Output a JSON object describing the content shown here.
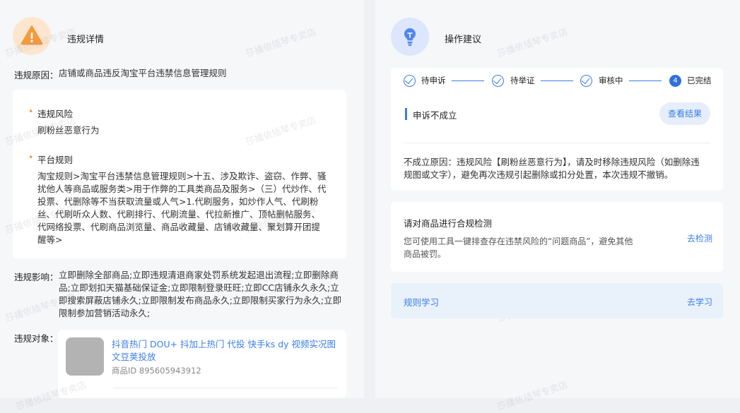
{
  "violation": {
    "title": "违规详情",
    "reason_label": "违规原因：",
    "reason_text": "店铺或商品违反淘宝平台违禁信息管理规则",
    "risk_title": "违规风险",
    "risk_text": "刷粉丝恶意行为",
    "rule_title": "平台规则",
    "rule_lines": [
      "淘宝规则>淘宝平台违禁信息管理规则>十五、涉及欺诈、盗窃、作弊、骚",
      "扰他人等商品或服务类>用于作弊的工具类商品及服务>（三）代炒作、代",
      "投票、代删除等不当获取流量或人气>1.代刷服务，如炒作人气、代刷粉",
      "丝、代刷听众人数、代刷排行、代刷流量、代拉新推广、顶帖删帖服务、",
      "代网络投票、代刷商品浏览量、商品收藏量、店铺收藏量、聚划算开团提",
      "醒等>"
    ],
    "impact_label": "违规影响：",
    "impact_lines": [
      "立即删除全部商品;立即违规清退商家处罚系统发起退出流程;立即删除商",
      "品;立即划扣天猫基础保证金;立即限制登录旺旺;立即CC店铺永久永久;立",
      "即搜索屏蔽店铺永久;立即限制发布商品永久;立即限制买家行为永久;立即",
      "限制参加营销活动永久;"
    ],
    "object_label": "违规对象：",
    "product_title_lines": [
      "抖音热门 DOU+ 抖加上热门 代投 快手ks dy 视频实况图",
      "文豆荚投放"
    ],
    "product_id": "商品ID 895605943912"
  },
  "advice": {
    "title": "操作建议",
    "steps": [
      {
        "label": "待申诉"
      },
      {
        "label": "待举证"
      },
      {
        "label": "审核中"
      },
      {
        "label": "已完结",
        "num": "4"
      }
    ],
    "appeal_status": "申诉不成立",
    "view_result_button": "查看结果",
    "fail_reason_lines": [
      "不成立原因：违规风险【刷粉丝恶意行为】，请及时移除违规风险（如删除违",
      "规图或文字），避免再次违规引起删除或扣分处置，本次违规不撤销。"
    ],
    "check_title": "请对商品进行合规检测",
    "check_text_lines": [
      "您可使用工具一键排查存在违禁风险的“问题商品”，避免其他",
      "商品被罚。"
    ],
    "check_link": "去检测",
    "learn_title": "规则学习",
    "learn_link": "去学习"
  },
  "watermark": "莎播依插琴专卖店",
  "colors": {
    "accent": "#3b7de9",
    "warning": "#f19a3c",
    "page_bg": "#f6f7f9"
  }
}
